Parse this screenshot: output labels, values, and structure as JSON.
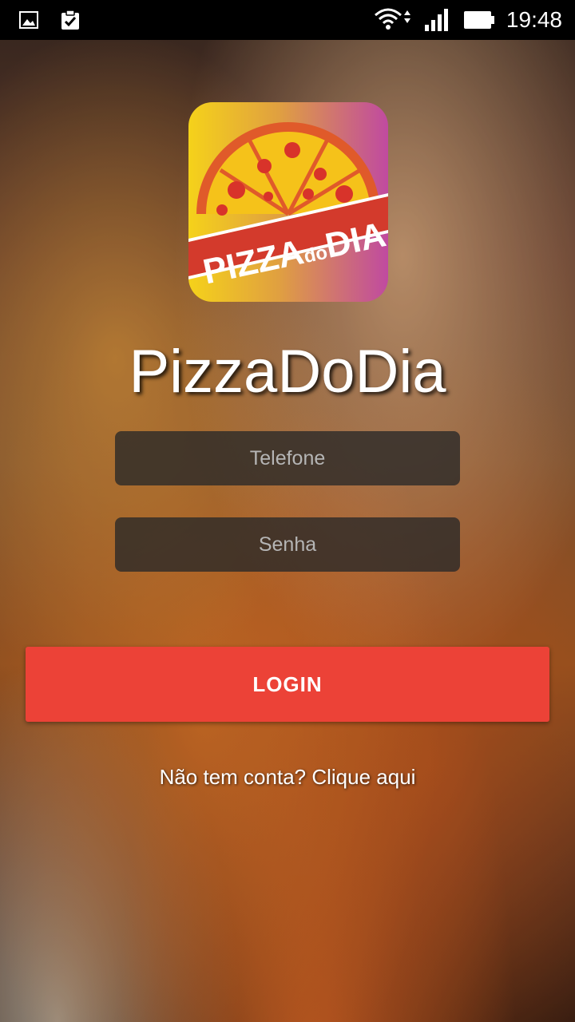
{
  "status_bar": {
    "time": "19:48",
    "icons": [
      "image-icon",
      "clipboard-check-icon",
      "wifi-icon",
      "signal-icon",
      "battery-icon"
    ]
  },
  "app": {
    "title": "PizzaDoDia",
    "logo_text": "PIZZA do DIA"
  },
  "form": {
    "phone_placeholder": "Telefone",
    "password_placeholder": "Senha",
    "login_label": "LOGIN",
    "signup_link": "Não tem conta? Clique aqui"
  },
  "colors": {
    "accent": "#ec4237",
    "field_bg": "#282828",
    "logo_yellow": "#f5d21a",
    "logo_purple": "#c04aa0"
  }
}
